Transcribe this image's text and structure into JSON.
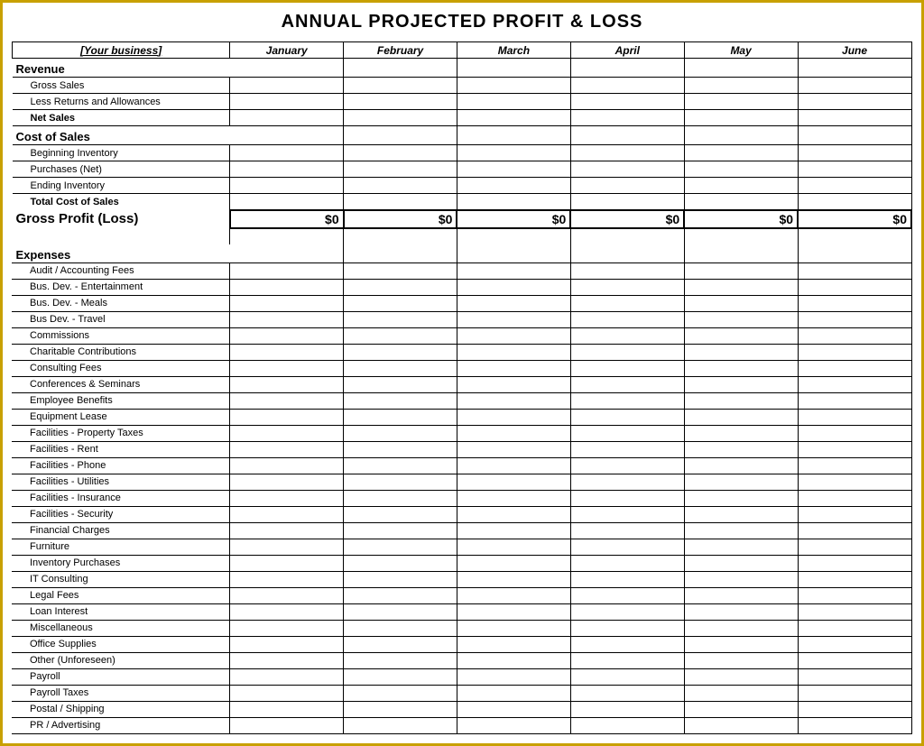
{
  "title": "ANNUAL PROJECTED PROFIT & LOSS",
  "header": {
    "business_label": "[Your business]",
    "columns": [
      "January",
      "February",
      "March",
      "April",
      "May",
      "June"
    ]
  },
  "sections": {
    "revenue": {
      "label": "Revenue",
      "rows": [
        "Gross Sales",
        "Less Returns and Allowances"
      ],
      "bold_rows": [
        "Net Sales"
      ]
    },
    "cost_of_sales": {
      "label": "Cost of Sales",
      "rows": [
        "Beginning Inventory",
        "Purchases (Net)",
        "Ending Inventory"
      ],
      "bold_rows": [
        "Total Cost of Sales"
      ]
    },
    "gross_profit": {
      "label": "Gross Profit (Loss)",
      "value": "$0"
    },
    "expenses": {
      "label": "Expenses",
      "rows": [
        "Audit / Accounting Fees",
        "Bus. Dev. - Entertainment",
        "Bus. Dev. - Meals",
        "Bus Dev. - Travel",
        "Commissions",
        "Charitable Contributions",
        "Consulting Fees",
        "Conferences & Seminars",
        "Employee Benefits",
        "Equipment Lease",
        "Facilities - Property Taxes",
        "Facilities - Rent",
        "Facilities - Phone",
        "Facilities - Utilities",
        "Facilities - Insurance",
        "Facilities - Security",
        "Financial Charges",
        "Furniture",
        "Inventory Purchases",
        "IT Consulting",
        "Legal Fees",
        "Loan Interest",
        "Miscellaneous",
        "Office Supplies",
        "Other (Unforeseen)",
        "Payroll",
        "Payroll Taxes",
        "Postal / Shipping",
        "PR / Advertising"
      ]
    }
  }
}
